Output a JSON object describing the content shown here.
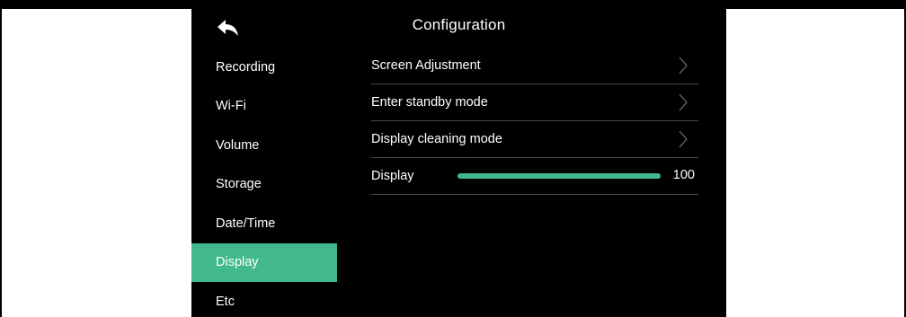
{
  "title": "Configuration",
  "back_icon": "back-arrow-icon",
  "accent_color": "#42b98d",
  "sidebar": {
    "items": [
      {
        "label": "Recording",
        "active": false
      },
      {
        "label": "Wi-Fi",
        "active": false
      },
      {
        "label": "Volume",
        "active": false
      },
      {
        "label": "Storage",
        "active": false
      },
      {
        "label": "Date/Time",
        "active": false
      },
      {
        "label": "Display",
        "active": true
      },
      {
        "label": "Etc",
        "active": false
      }
    ]
  },
  "content": {
    "rows": [
      {
        "label": "Screen Adjustment",
        "icon": "chevron-right-icon"
      },
      {
        "label": "Enter standby mode",
        "icon": "chevron-right-icon"
      },
      {
        "label": "Display cleaning mode",
        "icon": "chevron-right-icon"
      }
    ],
    "display_slider": {
      "label": "Display",
      "value": "100",
      "fraction": 1.0
    }
  }
}
